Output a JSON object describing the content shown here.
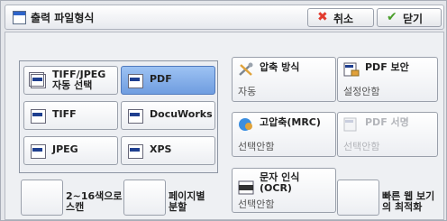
{
  "header": {
    "title": "출력 파일형식",
    "cancel_label": "취소",
    "close_label": "닫기"
  },
  "format_options": [
    {
      "label1": "TIFF/JPEG",
      "label2": "자동 선택"
    },
    {
      "label": "PDF",
      "selected": true
    },
    {
      "label": "TIFF"
    },
    {
      "label": "DocuWorks"
    },
    {
      "label": "JPEG"
    },
    {
      "label": "XPS"
    }
  ],
  "settings": {
    "compression": {
      "title": "압축 방식",
      "value": "자동"
    },
    "pdf_security": {
      "title": "PDF 보안",
      "value": "설정안함"
    },
    "high_compression": {
      "title": "고압축(MRC)",
      "value": "선택안함"
    },
    "pdf_signature": {
      "title": "PDF 서명",
      "value": "선택안함",
      "disabled": true
    },
    "ocr": {
      "title1": "문자 인식",
      "title2": "(OCR)",
      "value": "선택안함"
    }
  },
  "checkboxes": {
    "color_scan": {
      "label1": "2~16색으로",
      "label2": "스캔"
    },
    "split_pages": {
      "label1": "페이지별",
      "label2": "분할"
    },
    "fast_web": {
      "label1": "빠른 웹 보기",
      "label2": "의 최적화"
    }
  }
}
